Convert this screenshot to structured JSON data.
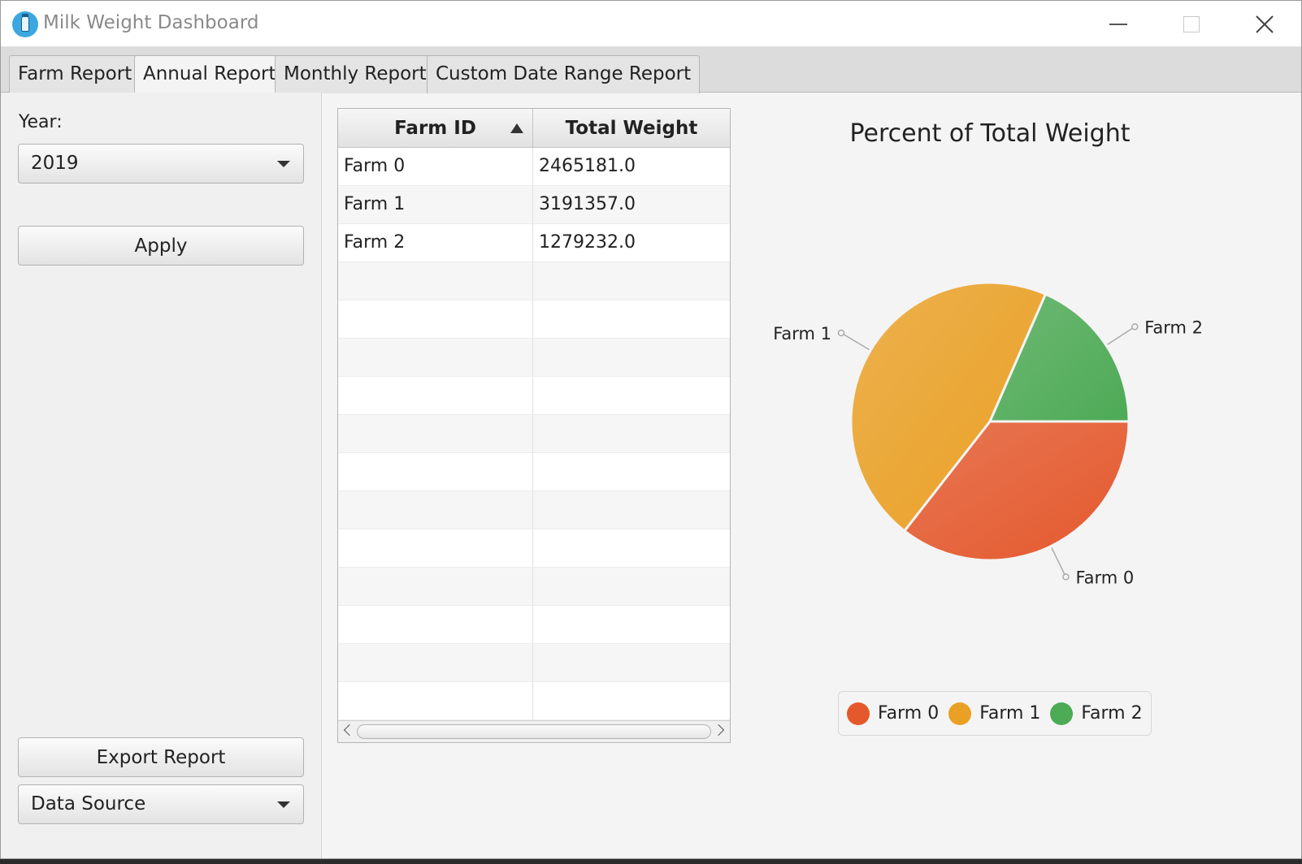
{
  "window": {
    "title": "Milk Weight Dashboard",
    "app_icon": "milk-bottle-icon"
  },
  "tabs": [
    {
      "label": "Farm Report",
      "active": false
    },
    {
      "label": "Annual Report",
      "active": true
    },
    {
      "label": "Monthly Report",
      "active": false
    },
    {
      "label": "Custom Date Range Report",
      "active": false
    }
  ],
  "controls": {
    "year_label": "Year:",
    "year_value": "2019",
    "apply_label": "Apply",
    "export_label": "Export Report",
    "data_source_value": "Data Source"
  },
  "table": {
    "columns": [
      "Farm ID",
      "Total Weight"
    ],
    "sorted_column": "Farm ID",
    "sort_direction": "ascending",
    "rows": [
      [
        "Farm 0",
        "2465181.0"
      ],
      [
        "Farm 1",
        "3191357.0"
      ],
      [
        "Farm 2",
        "1279232.0"
      ],
      [
        "",
        ""
      ],
      [
        "",
        ""
      ],
      [
        "",
        ""
      ],
      [
        "",
        ""
      ],
      [
        "",
        ""
      ],
      [
        "",
        ""
      ],
      [
        "",
        ""
      ],
      [
        "",
        ""
      ],
      [
        "",
        ""
      ],
      [
        "",
        ""
      ],
      [
        "",
        ""
      ],
      [
        "",
        ""
      ]
    ]
  },
  "chart_data": {
    "type": "pie",
    "title": "Percent of Total Weight",
    "categories": [
      "Farm 0",
      "Farm 1",
      "Farm 2"
    ],
    "values": [
      2465181.0,
      3191357.0,
      1279232.0
    ],
    "colors": [
      "#e4582c",
      "#eaa024",
      "#4daa55"
    ],
    "legend_position": "bottom"
  }
}
